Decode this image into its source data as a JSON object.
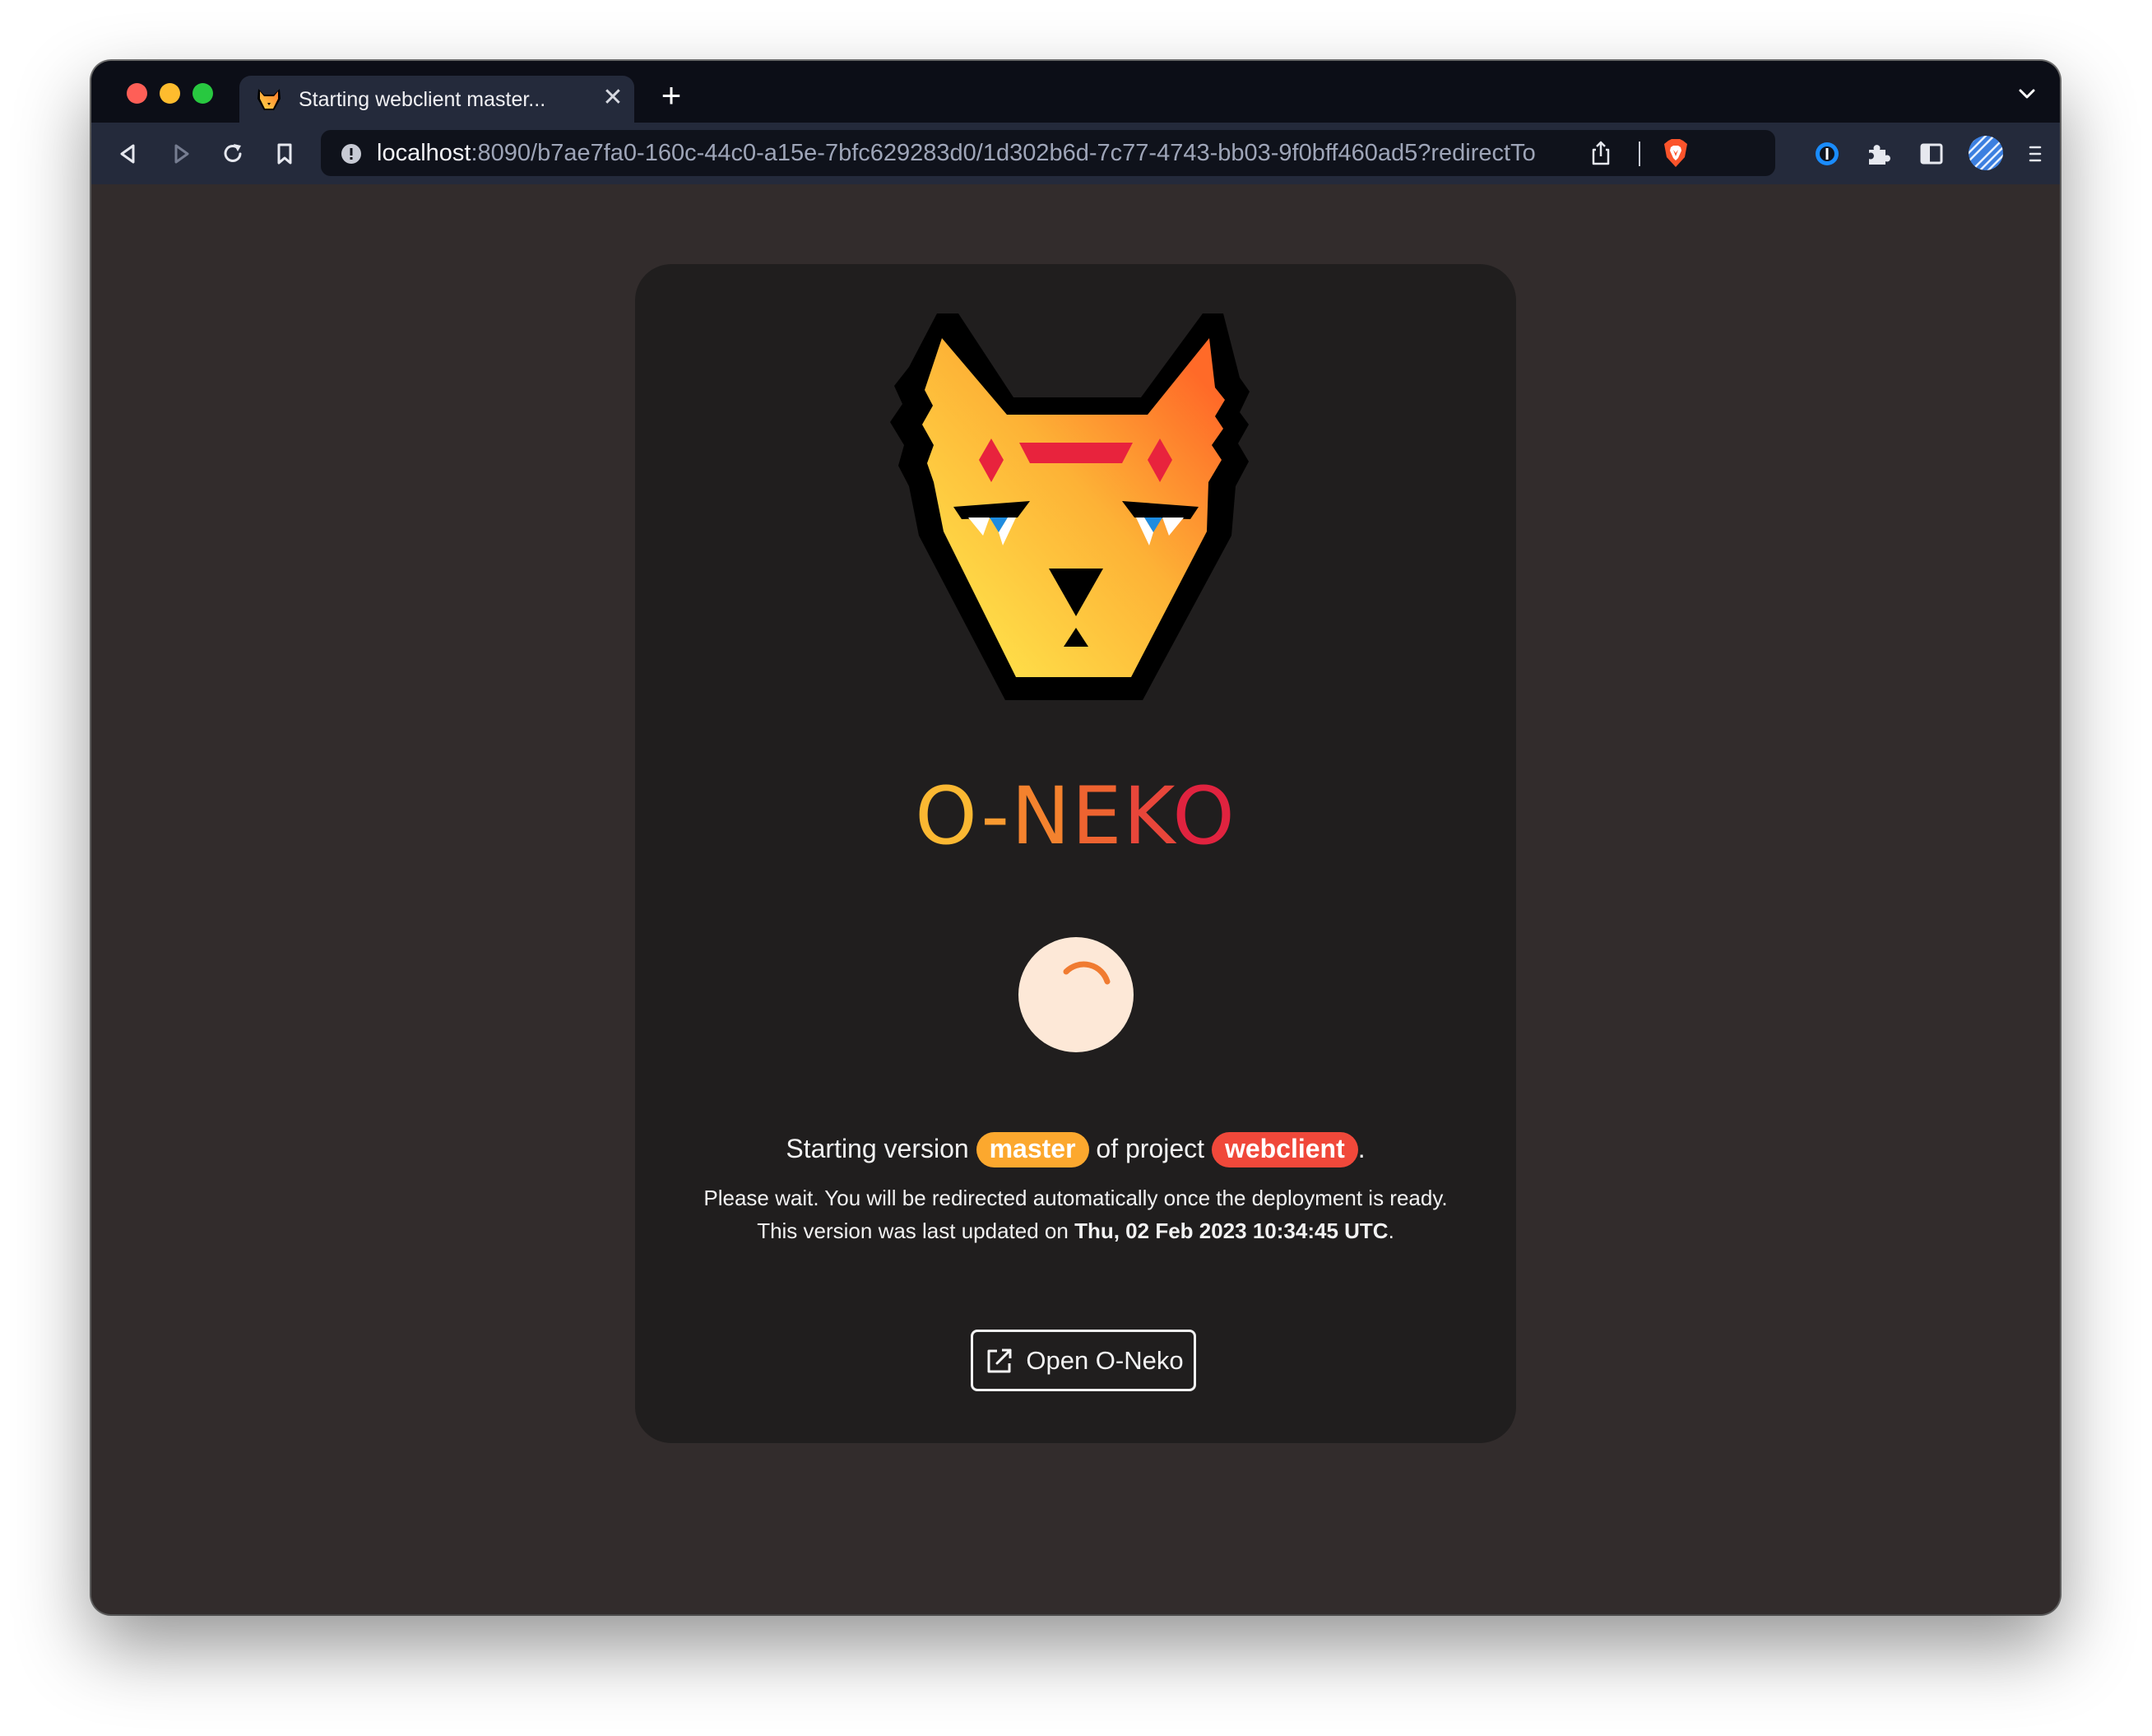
{
  "browser": {
    "tab": {
      "title": "Starting webclient master...",
      "favicon": "o-neko-cat-icon",
      "close_label": "✕"
    },
    "new_tab_label": "+",
    "address_bar": {
      "host": "localhost",
      "path": ":8090/b7ae7fa0-160c-44c0-a15e-7bfc629283d0/1d302b6d-7c77-4743-bb03-9f0bff460ad5?redirectTo..."
    },
    "toolbar_icons": [
      "back-icon",
      "forward-icon",
      "reload-icon",
      "bookmark-icon",
      "share-icon",
      "brave-shield-icon",
      "password-manager-icon",
      "extensions-icon",
      "sidebar-icon",
      "profile-avatar-icon",
      "menu-icon"
    ]
  },
  "page": {
    "brand": {
      "letters": [
        "O",
        "-",
        "N",
        "E",
        "K",
        "O"
      ]
    },
    "status": {
      "prefix": "Starting version",
      "version": "master",
      "middle": "of project",
      "project": "webclient",
      "suffix": "."
    },
    "wait_message": "Please wait. You will be redirected automatically once the deployment is ready.",
    "updated": {
      "prefix": "This version was last updated on",
      "date": "Thu, 02 Feb 2023 10:34:45 UTC",
      "suffix": "."
    },
    "open_button_label": "Open O-Neko"
  },
  "colors": {
    "page_background": "#322c2c",
    "card_background": "#201e1e",
    "master_badge": "#fca82e",
    "project_badge": "#f0483a",
    "spinner_background": "#fde8d7",
    "spinner_arc": "#f07b31"
  }
}
